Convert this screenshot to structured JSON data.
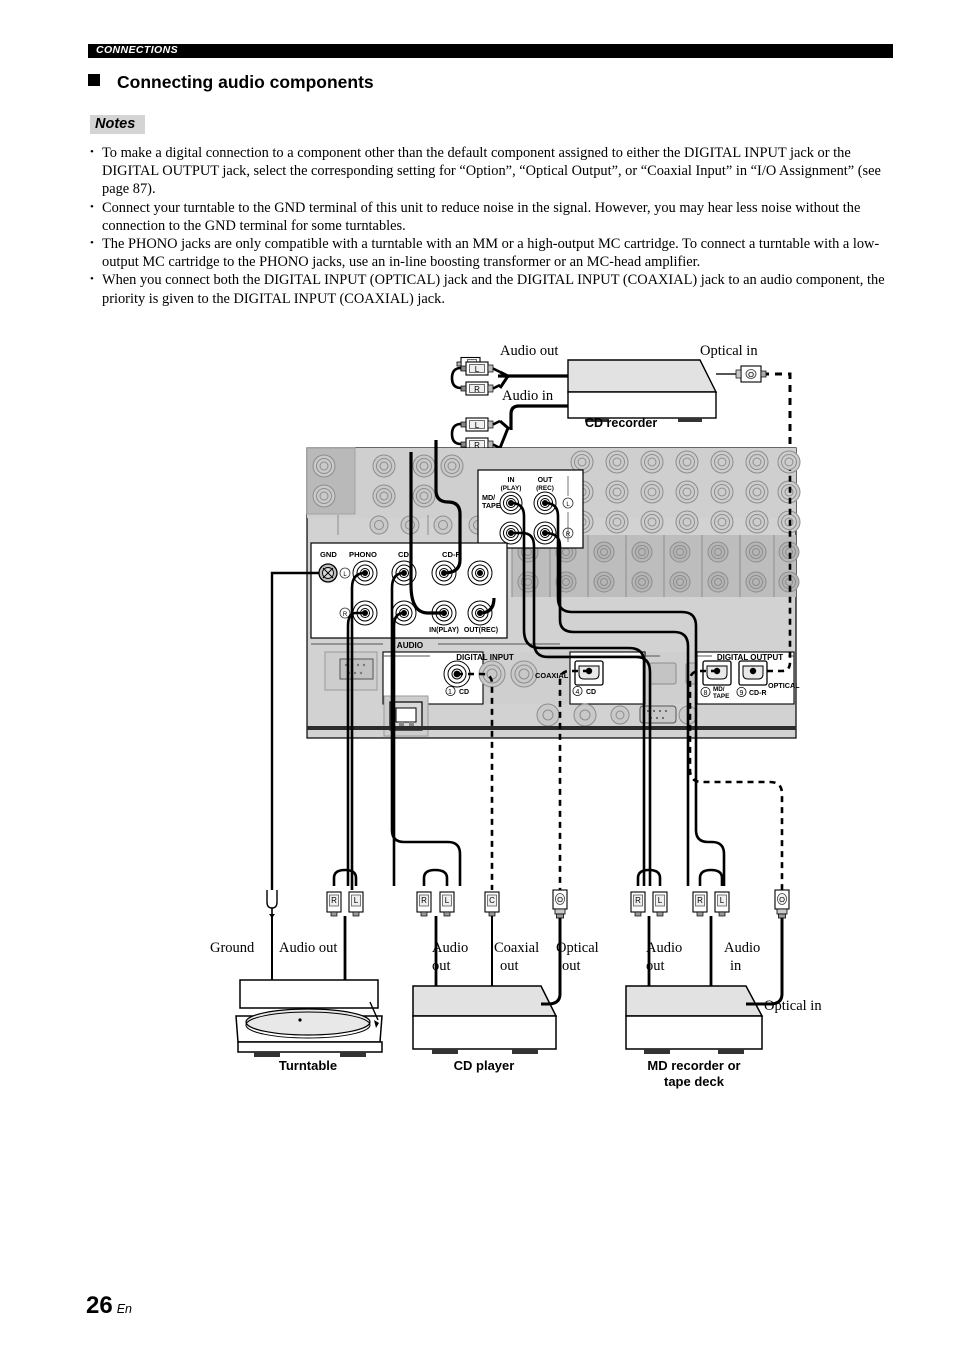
{
  "header": {
    "running_head": "CONNECTIONS",
    "section_title": "Connecting audio components",
    "notes_label": "Notes"
  },
  "notes": [
    "To make a digital connection to a component other than the default component assigned to either the DIGITAL INPUT jack or the DIGITAL OUTPUT jack, select the corresponding setting for “Option”, “Optical Output”, or “Coaxial Input” in “I/O Assignment” (see page 87).",
    "Connect your turntable to the GND terminal of this unit to reduce noise in the signal. However, you may hear less noise without the connection to the GND terminal for some turntables.",
    "The PHONO jacks are only compatible with a turntable with an MM or a high-output MC cartridge. To connect a turntable with a low-output MC cartridge to the PHONO jacks, use an in-line boosting transformer or an MC-head amplifier.",
    "When you connect both the DIGITAL INPUT (OPTICAL) jack and the DIGITAL INPUT (COAXIAL) jack to an audio component, the priority is given to the DIGITAL INPUT (COAXIAL) jack."
  ],
  "diagram": {
    "cd_recorder": {
      "device_label": "CD recorder",
      "audio_out_label": "Audio out",
      "audio_in_label": "Audio in",
      "optical_in_label": "Optical in",
      "plug_l": "L",
      "plug_r": "R",
      "plug_optical": "O"
    },
    "rear_panel": {
      "gnd_label": "GND",
      "phono_label": "PHONO",
      "cd_label": "CD",
      "cdr_label": "CD-R",
      "cdr_in_label": "IN(PLAY)",
      "cdr_out_label": "OUT(REC)",
      "audio_label": "AUDIO",
      "mdtape_label": "MD/\nTAPE",
      "mdtape_label_line1": "MD/",
      "mdtape_label_line2": "TAPE",
      "in_label_line1": "IN",
      "in_label_line2": "(PLAY)",
      "out_label_line1": "OUT",
      "out_label_line2": "(REC)",
      "channel_l": "L",
      "channel_r": "R",
      "digital_input_label": "DIGITAL INPUT",
      "digital_output_label": "DIGITAL OUTPUT",
      "coaxial_label": "COAXIAL",
      "optical_label": "OPTICAL",
      "din_1_num": "1",
      "din_1_label": "CD",
      "din_4_num": "4",
      "din_4_label": "CD",
      "dout_8_num": "8",
      "dout_8_label_line1": "MD/",
      "dout_8_label_line2": "TAPE",
      "dout_9_num": "9",
      "dout_9_label": "CD-R"
    },
    "turntable": {
      "device_label": "Turntable",
      "ground_label": "Ground",
      "audio_out_label": "Audio out",
      "plug_l": "L",
      "plug_r": "R"
    },
    "cd_player": {
      "device_label": "CD player",
      "audio_out_line1": "Audio",
      "audio_out_line2": "out",
      "coaxial_out_line1": "Coaxial",
      "coaxial_out_line2": "out",
      "optical_out_line1": "Optical",
      "optical_out_line2": "out",
      "plug_l": "L",
      "plug_r": "R",
      "plug_coaxial": "C",
      "plug_optical": "O"
    },
    "md_recorder": {
      "device_label_line1": "MD recorder or",
      "device_label_line2": "tape deck",
      "audio_out_line1": "Audio",
      "audio_out_line2": "out",
      "audio_in_line1": "Audio",
      "audio_in_line2": "in",
      "optical_in_label": "Optical in",
      "plug_l": "L",
      "plug_r": "R",
      "plug_optical": "O"
    }
  },
  "footer": {
    "page_number": "26",
    "language": "En"
  },
  "colors": {
    "panel_light": "#d9d9d9",
    "panel_mid": "#c4c4c4",
    "panel_dark": "#b3b3b3",
    "device_top": "#e2e2e2",
    "ink": "#000000"
  }
}
